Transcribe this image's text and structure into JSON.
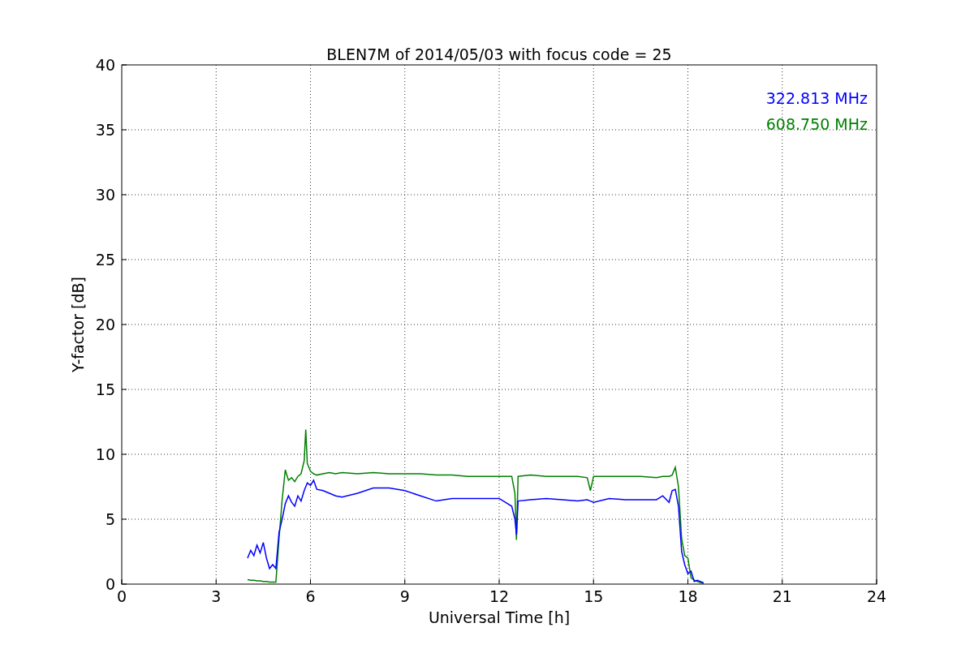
{
  "chart_data": {
    "type": "line",
    "title": "BLEN7M of 2014/05/03 with focus code = 25",
    "xlabel": "Universal Time [h]",
    "ylabel": "Y-factor [dB]",
    "xlim": [
      0,
      24
    ],
    "ylim": [
      0,
      40
    ],
    "xticks": [
      0,
      3,
      6,
      9,
      12,
      15,
      18,
      21,
      24
    ],
    "yticks": [
      0,
      5,
      10,
      15,
      20,
      25,
      30,
      35,
      40
    ],
    "grid": true,
    "x": [
      4.0,
      4.1,
      4.2,
      4.3,
      4.4,
      4.5,
      4.6,
      4.7,
      4.8,
      4.9,
      5.0,
      5.1,
      5.2,
      5.3,
      5.4,
      5.5,
      5.6,
      5.7,
      5.8,
      5.85,
      5.9,
      6.0,
      6.1,
      6.2,
      6.4,
      6.6,
      6.8,
      7.0,
      7.5,
      8.0,
      8.5,
      9.0,
      9.5,
      10.0,
      10.5,
      11.0,
      11.5,
      12.0,
      12.4,
      12.5,
      12.55,
      12.6,
      13.0,
      13.5,
      14.0,
      14.5,
      14.8,
      14.9,
      15.0,
      15.5,
      16.0,
      16.5,
      17.0,
      17.2,
      17.4,
      17.5,
      17.6,
      17.7,
      17.8,
      17.9,
      18.0,
      18.1,
      18.2,
      18.3,
      18.5
    ],
    "series": [
      {
        "name": "322.813 MHz",
        "color": "#0000ff",
        "values": [
          2.0,
          2.6,
          2.2,
          3.0,
          2.4,
          3.2,
          2.0,
          1.2,
          1.5,
          1.2,
          4.0,
          5.0,
          6.2,
          6.8,
          6.3,
          6.0,
          6.8,
          6.4,
          7.2,
          7.5,
          7.8,
          7.6,
          8.0,
          7.3,
          7.2,
          7.0,
          6.8,
          6.7,
          7.0,
          7.4,
          7.4,
          7.2,
          6.8,
          6.4,
          6.6,
          6.6,
          6.6,
          6.6,
          6.0,
          5.0,
          3.8,
          6.4,
          6.5,
          6.6,
          6.5,
          6.4,
          6.5,
          6.4,
          6.3,
          6.6,
          6.5,
          6.5,
          6.5,
          6.8,
          6.3,
          7.2,
          7.3,
          6.0,
          2.5,
          1.5,
          0.8,
          1.0,
          0.2,
          0.3,
          0.1
        ]
      },
      {
        "name": "608.750 MHz",
        "color": "#008000",
        "values": [
          0.35,
          0.3,
          0.3,
          0.25,
          0.25,
          0.2,
          0.2,
          0.15,
          0.15,
          0.15,
          3.5,
          6.5,
          8.8,
          8.0,
          8.2,
          7.9,
          8.3,
          8.5,
          9.5,
          11.9,
          9.3,
          8.7,
          8.5,
          8.4,
          8.5,
          8.6,
          8.5,
          8.6,
          8.5,
          8.6,
          8.5,
          8.5,
          8.5,
          8.4,
          8.4,
          8.3,
          8.3,
          8.3,
          8.3,
          7.0,
          3.4,
          8.3,
          8.4,
          8.3,
          8.3,
          8.3,
          8.2,
          7.2,
          8.3,
          8.3,
          8.3,
          8.3,
          8.2,
          8.3,
          8.3,
          8.4,
          9.0,
          7.5,
          3.5,
          2.2,
          2.0,
          0.5,
          0.3,
          0.2,
          0.05
        ]
      }
    ]
  }
}
